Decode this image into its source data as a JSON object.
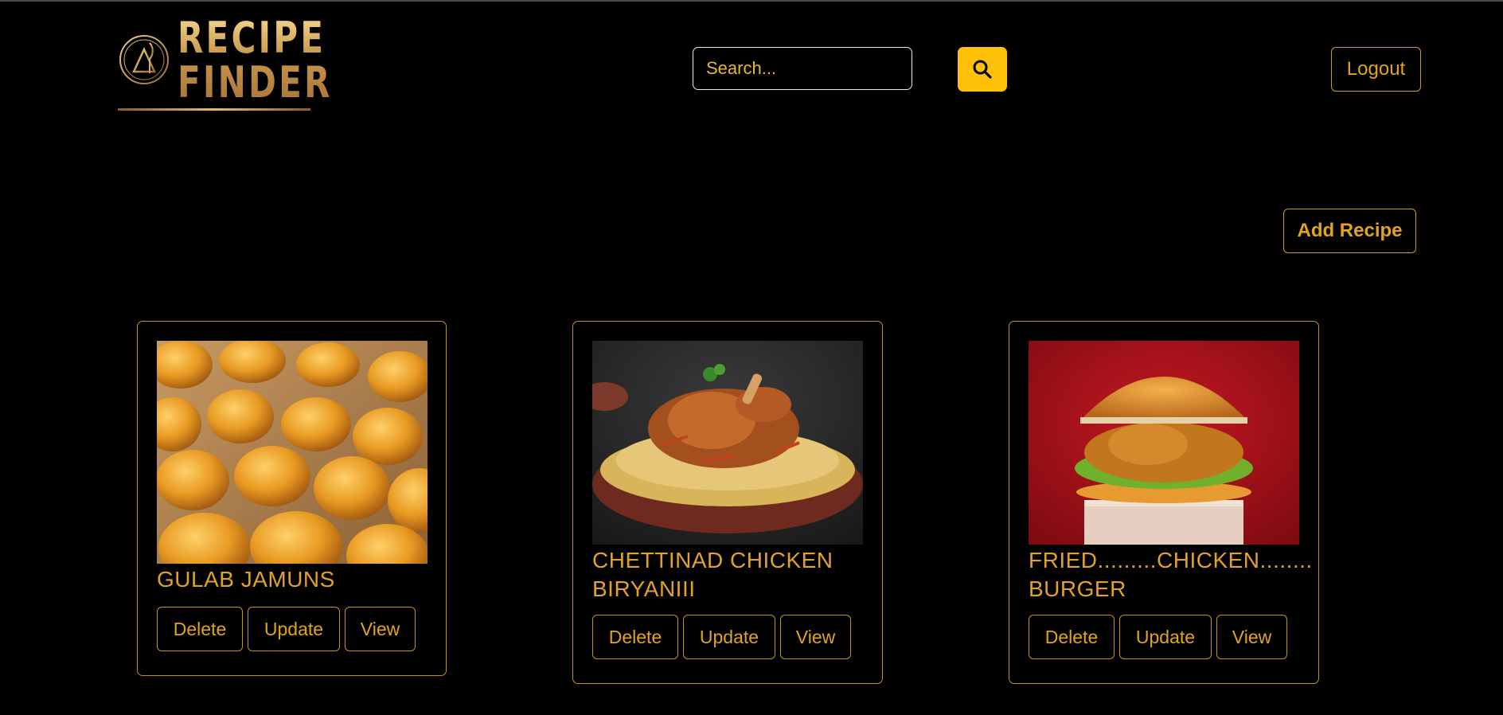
{
  "header": {
    "logo_line1": "RECIPE",
    "logo_line2": "FINDER",
    "search_placeholder": "Search...",
    "search_icon": "search-icon",
    "logout_label": "Logout"
  },
  "main": {
    "add_recipe_label": "Add Recipe"
  },
  "recipes": [
    {
      "title": "GULAB JAMUNS",
      "image": "gulab-jamuns-photo",
      "delete_label": "Delete",
      "update_label": "Update",
      "view_label": "View"
    },
    {
      "title": "CHETTINAD CHICKEN BIRYANIII",
      "image": "chicken-biryani-photo",
      "delete_label": "Delete",
      "update_label": "Update",
      "view_label": "View"
    },
    {
      "title": "FRIED.........CHICKEN........ BURGER",
      "image": "fried-chicken-burger-photo",
      "delete_label": "Delete",
      "update_label": "Update",
      "view_label": "View"
    }
  ],
  "colors": {
    "background": "#000000",
    "accent": "#ffc107",
    "gold_text": "#e3a41d",
    "border": "#c8901c"
  }
}
